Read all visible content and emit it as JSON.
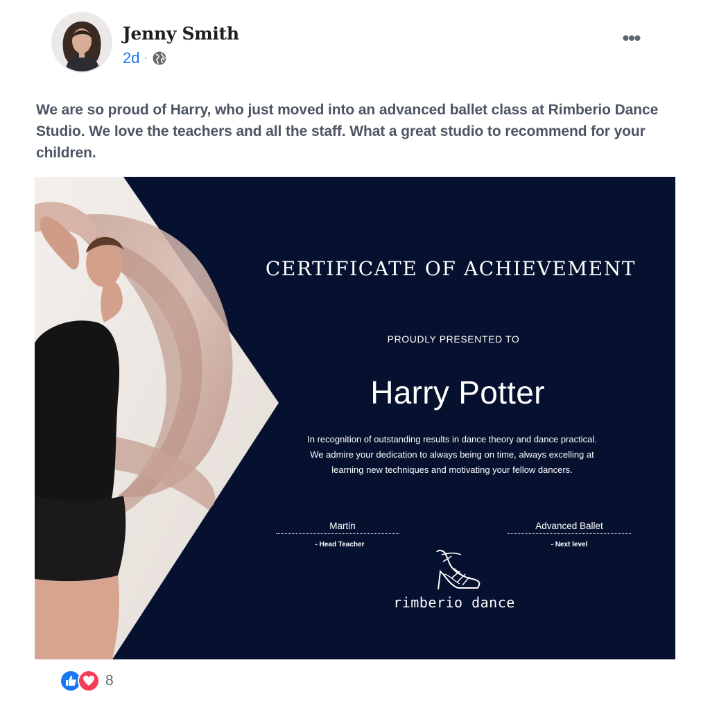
{
  "post": {
    "author": "Jenny Smith",
    "time": "2d",
    "separator": "·",
    "privacy_icon": "globe-icon",
    "more_icon": "more-options-icon",
    "more_label": "•••",
    "text": "We are so proud of Harry, who just moved into an advanced ballet class at Rimberio Dance Studio. We love the teachers and all the staff. What a great studio to recommend for your children."
  },
  "certificate": {
    "title": "CERTIFICATE OF ACHIEVEMENT",
    "subtitle": "PROUDLY PRESENTED TO",
    "recipient": "Harry Potter",
    "body_lines": [
      "In recognition of outstanding results in dance theory and dance practical.",
      "We admire your dedication to always being on time, always excelling at",
      "learning new techniques and motivating your fellow dancers."
    ],
    "signatures": [
      {
        "name": "Martin",
        "role": "- Head Teacher"
      },
      {
        "name": "Advanced Ballet",
        "role": "- Next level"
      }
    ],
    "brand": "rimberio dance",
    "colors": {
      "background": "#061130",
      "text": "#ffffff",
      "fabric": "#c9a79c"
    }
  },
  "reactions": {
    "icons": [
      "like-icon",
      "love-icon"
    ],
    "count": "8",
    "colors": {
      "like": "#1877f2",
      "love": "#f33e58"
    }
  }
}
